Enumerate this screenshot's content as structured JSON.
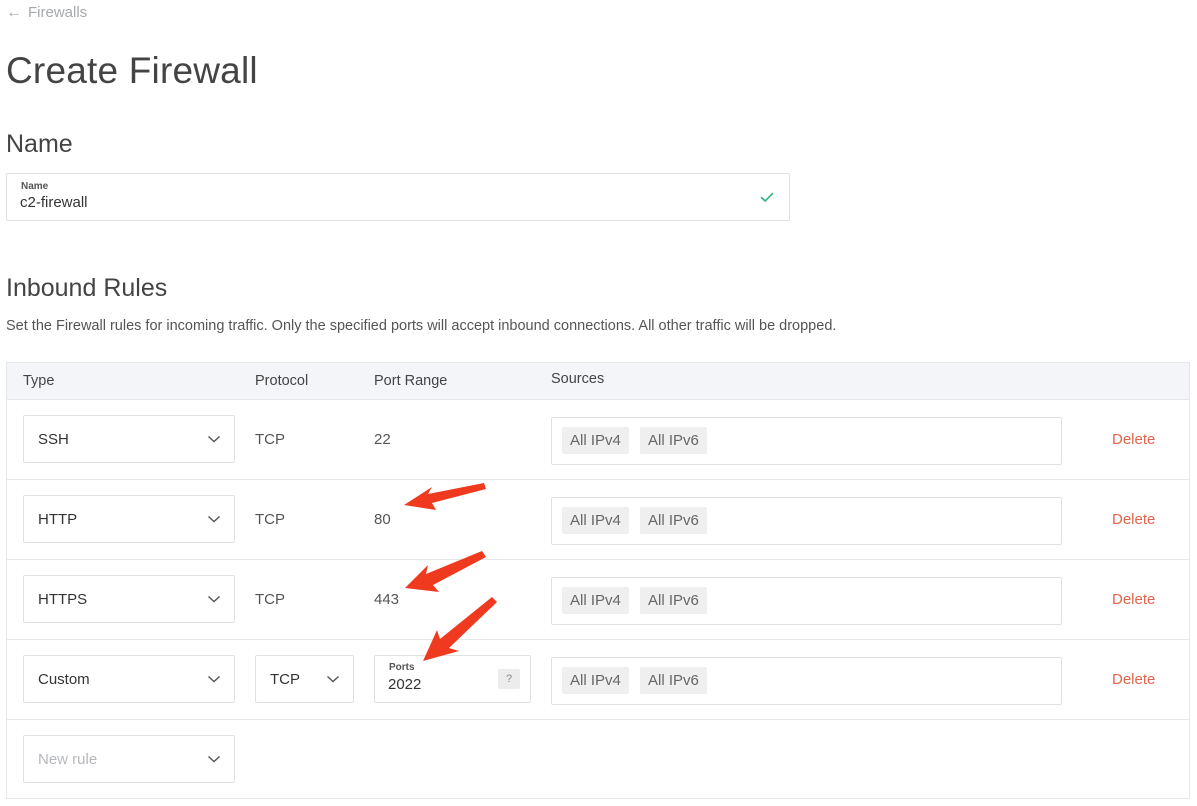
{
  "breadcrumb": {
    "back_label": "Firewalls"
  },
  "page": {
    "title": "Create Firewall"
  },
  "name_section": {
    "heading": "Name",
    "field_label": "Name",
    "field_value": "c2-firewall"
  },
  "inbound": {
    "heading": "Inbound Rules",
    "description": "Set the Firewall rules for incoming traffic. Only the specified ports will accept inbound connections. All other traffic will be dropped.",
    "columns": {
      "type": "Type",
      "protocol": "Protocol",
      "port_range": "Port Range",
      "sources": "Sources"
    },
    "rules": [
      {
        "type": "SSH",
        "protocol": "TCP",
        "port_range": "22",
        "sources": [
          "All IPv4",
          "All IPv6"
        ],
        "delete_label": "Delete"
      },
      {
        "type": "HTTP",
        "protocol": "TCP",
        "port_range": "80",
        "sources": [
          "All IPv4",
          "All IPv6"
        ],
        "delete_label": "Delete"
      },
      {
        "type": "HTTPS",
        "protocol": "TCP",
        "port_range": "443",
        "sources": [
          "All IPv4",
          "All IPv6"
        ],
        "delete_label": "Delete"
      },
      {
        "type": "Custom",
        "protocol": "TCP",
        "ports_label": "Ports",
        "ports_value": "2022",
        "help_label": "?",
        "sources": [
          "All IPv4",
          "All IPv6"
        ],
        "delete_label": "Delete"
      }
    ],
    "new_rule": {
      "placeholder": "New rule"
    }
  },
  "colors": {
    "accent_delete": "#e0654a",
    "check_green": "#2ab57d",
    "annotation_arrow": "#f03a1f"
  }
}
